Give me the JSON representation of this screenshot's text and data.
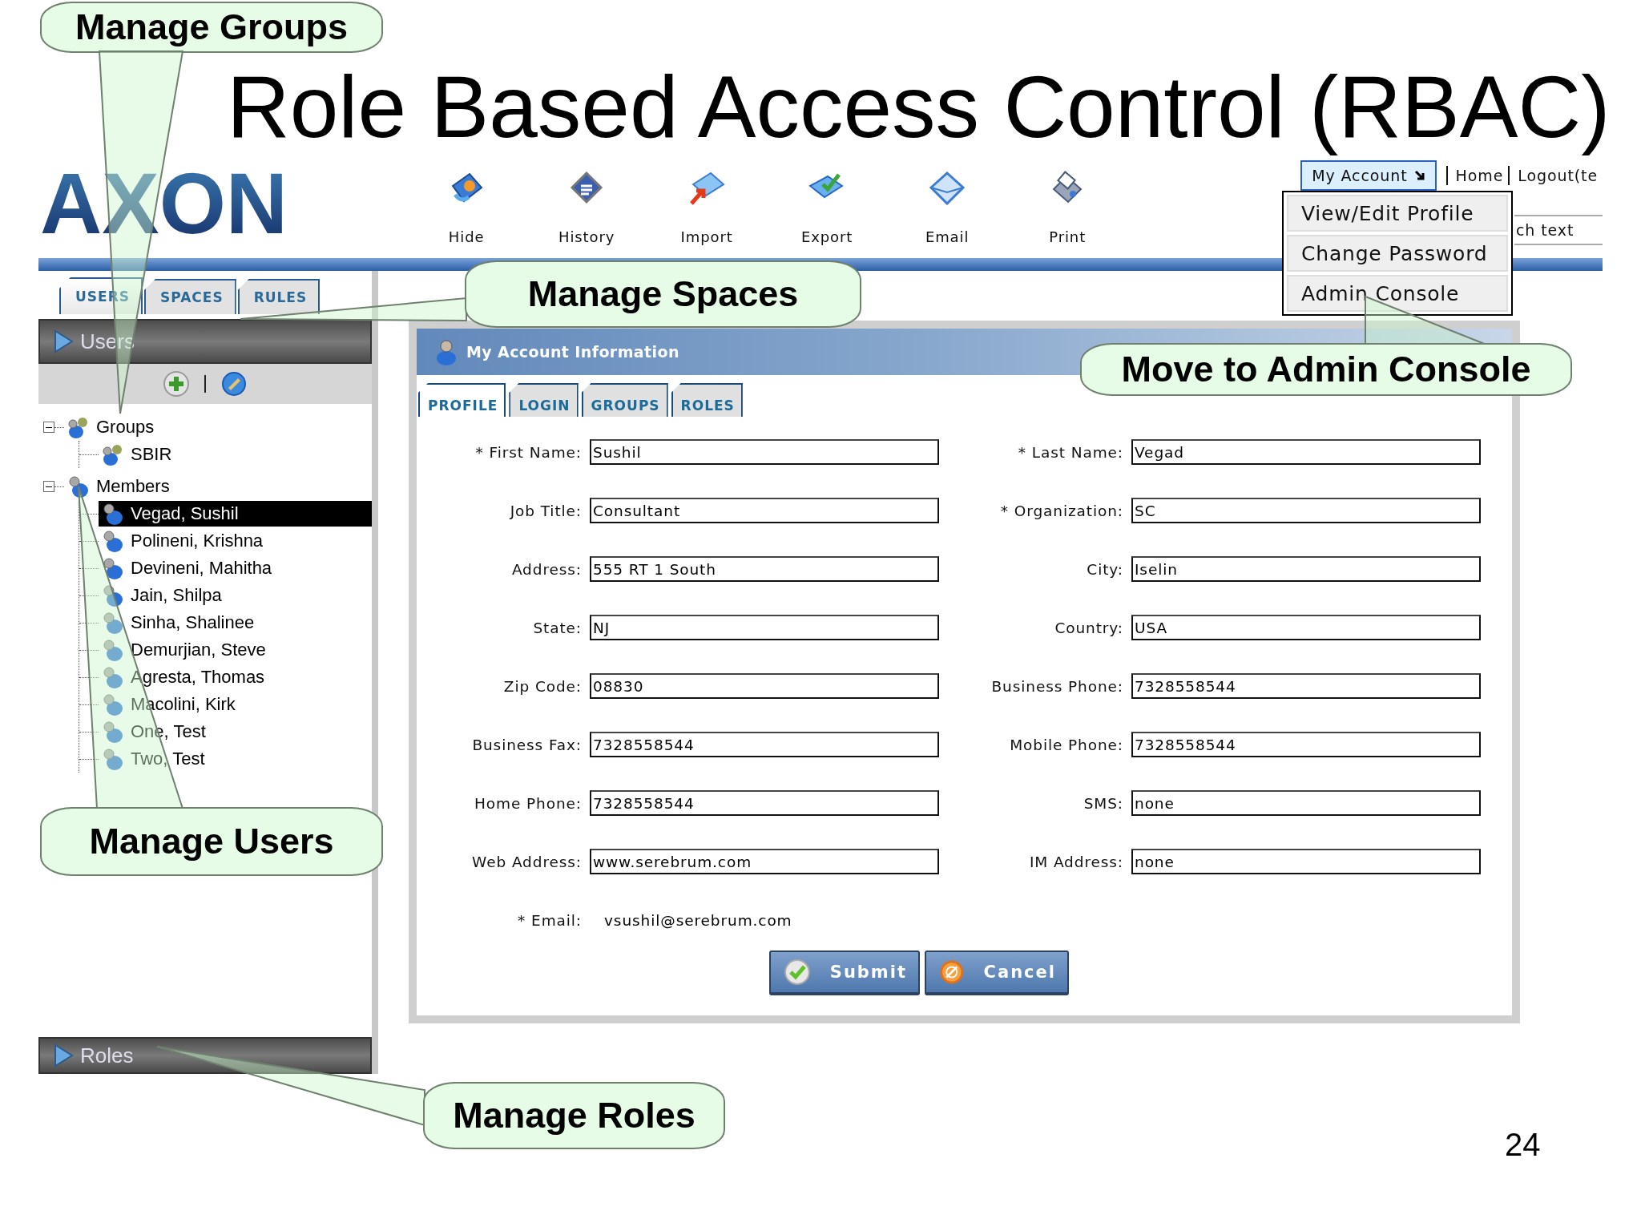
{
  "title": "Role Based Access Control (RBAC)",
  "logo": "AXON",
  "toolbar": [
    {
      "label": "Hide",
      "kind": "hide"
    },
    {
      "label": "History",
      "kind": "history"
    },
    {
      "label": "Import",
      "kind": "import"
    },
    {
      "label": "Export",
      "kind": "export"
    },
    {
      "label": "Email",
      "kind": "email"
    },
    {
      "label": "Print",
      "kind": "print"
    }
  ],
  "account_menu": {
    "label": "My Account",
    "expanded": true,
    "items": [
      "View/Edit Profile",
      "Change Password",
      "Admin Console"
    ]
  },
  "links": [
    "Home",
    "Logout(te"
  ],
  "search": {
    "value": "ch text"
  },
  "sidebar": {
    "tabs": [
      {
        "label": "USERS",
        "selected": true
      },
      {
        "label": "SPACES",
        "selected": false
      },
      {
        "label": "RULES",
        "selected": false
      }
    ],
    "header": "Users",
    "tree": [
      {
        "label": "Groups",
        "kind": "group",
        "expanded": true,
        "selected": false,
        "children": [
          {
            "label": "SBIR",
            "kind": "group",
            "selected": false
          }
        ]
      },
      {
        "label": "Members",
        "kind": "user",
        "expanded": true,
        "selected": false,
        "children": [
          {
            "label": "Vegad, Sushil",
            "kind": "user",
            "selected": true
          },
          {
            "label": "Polineni, Krishna",
            "kind": "user",
            "selected": false
          },
          {
            "label": "Devineni, Mahitha",
            "kind": "user",
            "selected": false
          },
          {
            "label": "Jain, Shilpa",
            "kind": "user",
            "selected": false
          },
          {
            "label": "Sinha, Shalinee",
            "kind": "user",
            "selected": false
          },
          {
            "label": "Demurjian, Steve",
            "kind": "user",
            "selected": false
          },
          {
            "label": "Agresta, Thomas",
            "kind": "user",
            "selected": false
          },
          {
            "label": "Macolini, Kirk",
            "kind": "user",
            "selected": false
          },
          {
            "label": "One, Test",
            "kind": "user",
            "selected": false
          },
          {
            "label": "Two, Test",
            "kind": "user",
            "selected": false
          }
        ]
      }
    ],
    "footer": "Roles"
  },
  "panel": {
    "title": "My Account Information",
    "tabs": [
      {
        "label": "PROFILE",
        "selected": true
      },
      {
        "label": "LOGIN",
        "selected": false
      },
      {
        "label": "GROUPS",
        "selected": false
      },
      {
        "label": "ROLES",
        "selected": false
      }
    ],
    "fields": [
      {
        "label": "* First Name:",
        "value": "Sushil"
      },
      {
        "label": "* Last Name:",
        "value": "Vegad"
      },
      {
        "label": "Job Title:",
        "value": "Consultant"
      },
      {
        "label": "* Organization:",
        "value": "SC"
      },
      {
        "label": "Address:",
        "value": "555 RT 1 South"
      },
      {
        "label": "City:",
        "value": "Iselin"
      },
      {
        "label": "State:",
        "value": "NJ"
      },
      {
        "label": "Country:",
        "value": "USA"
      },
      {
        "label": "Zip Code:",
        "value": "08830"
      },
      {
        "label": "Business Phone:",
        "value": "7328558544"
      },
      {
        "label": "Business Fax:",
        "value": "7328558544"
      },
      {
        "label": "Mobile Phone:",
        "value": "7328558544"
      },
      {
        "label": "Home Phone:",
        "value": "7328558544"
      },
      {
        "label": "SMS:",
        "value": "none"
      },
      {
        "label": "Web Address:",
        "value": "www.serebrum.com"
      },
      {
        "label": "IM Address:",
        "value": "none"
      }
    ],
    "email": {
      "label": "* Email:",
      "value": "vsushil@serebrum.com"
    },
    "buttons": [
      {
        "label": "Submit",
        "kind": "submit"
      },
      {
        "label": "Cancel",
        "kind": "cancel"
      }
    ]
  },
  "callouts": [
    "Manage Groups",
    "Manage Spaces",
    "Move to Admin Console",
    "Manage Users",
    "Manage Roles"
  ],
  "page_number": "24"
}
